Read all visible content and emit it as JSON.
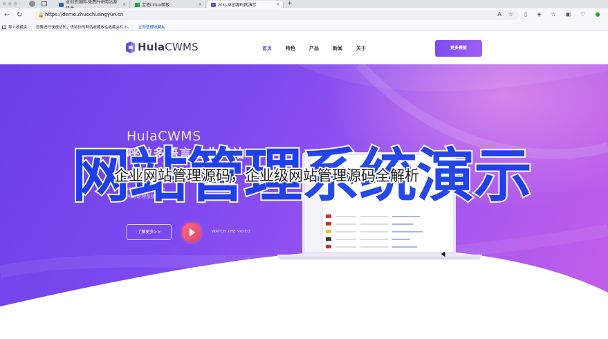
{
  "browser": {
    "tabs": [
      {
        "label": "卓创资源网-免费PHP网站源码收",
        "active": false,
        "favicon_color": "#2a64c8"
      },
      {
        "label": "宝塔Linux面板",
        "active": false,
        "favicon_color": "#20a53a"
      },
      {
        "label": "zckj-卓创源码网演示",
        "active": true,
        "favicon_color": "#5b57d8"
      }
    ],
    "tab_close": "×",
    "new_tab": "+",
    "url": "https://demo.zhuochuangyun.cn",
    "favorites": {
      "import_label": "导入收藏夹",
      "hint": "若要进行快速访问，请将你的网站收藏放在收藏夹栏上。",
      "link": "立即管理收藏夹"
    }
  },
  "site": {
    "logo_bold": "Hula",
    "logo_light": "CWMS",
    "nav": [
      "首页",
      "特色",
      "产品",
      "新闻",
      "关于"
    ],
    "nav_active_index": 0,
    "more_button": "更多模板"
  },
  "hero": {
    "brand": "HulaCWMS",
    "slogan": "呼啦多语言企业网站",
    "desc_lines": [
      "可视化拖拽，后台",
      "网站管理系统，简单易用"
    ],
    "learn_more": "了解更多>>",
    "watch_video": "WATCH THE VIDEO"
  },
  "overlay": {
    "big_title": "网站管理系统演示",
    "caption": "企业网站管理源码，企业级网站管理源码全解析"
  },
  "colors": {
    "accent": "#5b57d8",
    "hero_start": "#6b3fe8",
    "hero_end": "#c45fe8",
    "overlay_blue": "#1a3fe8"
  }
}
